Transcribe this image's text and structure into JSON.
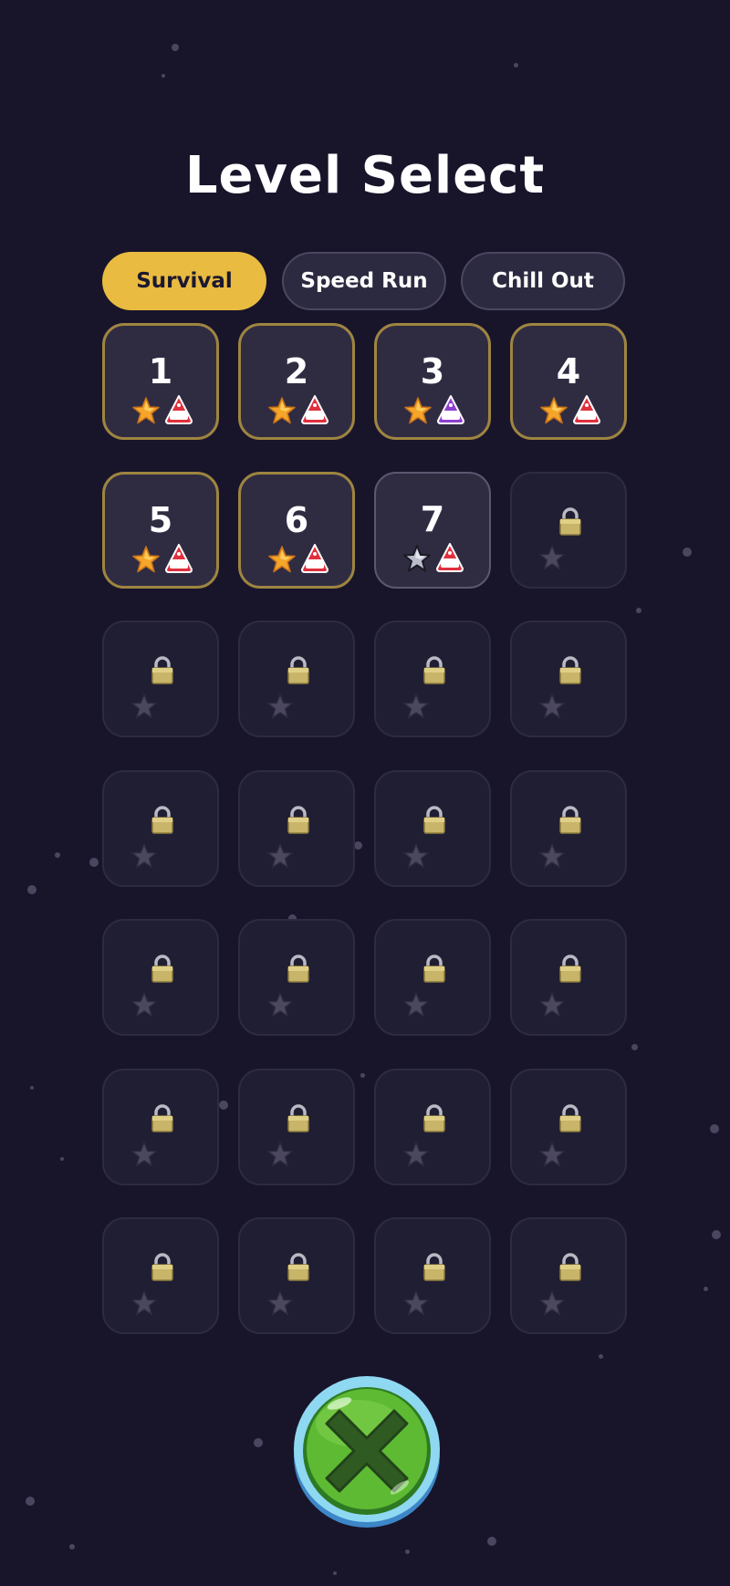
{
  "title": "Level Select",
  "tabs": [
    {
      "label": "Survival",
      "active": true
    },
    {
      "label": "Speed Run",
      "active": false
    },
    {
      "label": "Chill Out",
      "active": false
    }
  ],
  "levels": [
    {
      "number": "1",
      "status": "completed",
      "star": "gold",
      "badge": "NO.1"
    },
    {
      "number": "2",
      "status": "completed",
      "star": "gold",
      "badge": "NO.1"
    },
    {
      "number": "3",
      "status": "completed",
      "star": "gold",
      "badge": "2ND PLACE"
    },
    {
      "number": "4",
      "status": "completed",
      "star": "gold",
      "badge": "NO.1"
    },
    {
      "number": "5",
      "status": "completed",
      "star": "gold",
      "badge": "NO.1"
    },
    {
      "number": "6",
      "status": "completed",
      "star": "gold",
      "badge": "NO.1"
    },
    {
      "number": "7",
      "status": "unlocked",
      "star": "silver",
      "badge": "NO.1"
    },
    {
      "status": "locked"
    },
    {
      "status": "locked"
    },
    {
      "status": "locked"
    },
    {
      "status": "locked"
    },
    {
      "status": "locked"
    },
    {
      "status": "locked"
    },
    {
      "status": "locked"
    },
    {
      "status": "locked"
    },
    {
      "status": "locked"
    },
    {
      "status": "locked"
    },
    {
      "status": "locked"
    },
    {
      "status": "locked"
    },
    {
      "status": "locked"
    },
    {
      "status": "locked"
    },
    {
      "status": "locked"
    },
    {
      "status": "locked"
    },
    {
      "status": "locked"
    },
    {
      "status": "locked"
    },
    {
      "status": "locked"
    },
    {
      "status": "locked"
    },
    {
      "status": "locked"
    }
  ],
  "close_button": {
    "icon": "close-x-icon"
  },
  "colors": {
    "background": "#18152b",
    "active_tab": "#e9bb40",
    "completed_border": "#9e8540",
    "close_green": "#5dba32",
    "close_ring": "#7fd0f0"
  }
}
